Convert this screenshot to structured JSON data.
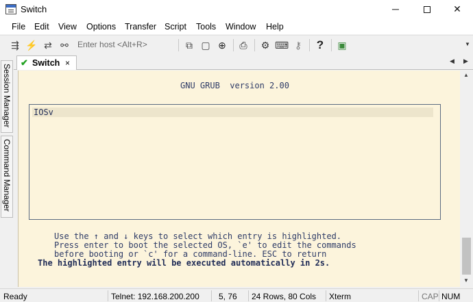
{
  "window": {
    "title": "Switch",
    "minimize_glyph": "─",
    "close_glyph": "✕"
  },
  "menu": [
    "File",
    "Edit",
    "View",
    "Options",
    "Transfer",
    "Script",
    "Tools",
    "Window",
    "Help"
  ],
  "toolbar": {
    "host_placeholder": "Enter host <Alt+R>",
    "icons": [
      "connect-icon",
      "quick-connect-icon",
      "reconnect-icon",
      "disconnect-icon",
      "copy-icon",
      "paste-icon",
      "find-icon",
      "print-icon",
      "settings-icon",
      "keymap-icon",
      "key-icon",
      "help-icon",
      "sftp-icon"
    ]
  },
  "tabs": [
    {
      "label": "Switch",
      "status": "connected",
      "close": "×"
    }
  ],
  "sidebar": {
    "session_manager": "Session Manager",
    "command_manager": "Command Manager"
  },
  "terminal": {
    "header": "GNU GRUB  version 2.00",
    "entries": [
      "IOSv"
    ],
    "help_lines": [
      "Use the ↑ and ↓ keys to select which entry is highlighted.",
      "Press enter to boot the selected OS, `e' to edit the commands",
      "before booting or `c' for a command-line. ESC to return"
    ],
    "countdown": "The highlighted entry will be executed automatically in 2s.",
    "background": "#fcf4dc",
    "foreground": "#2d3a66"
  },
  "status": {
    "state": "Ready",
    "connection": "Telnet: 192.168.200.200",
    "cursor": "5,  76",
    "size": "24 Rows, 80 Cols",
    "terminal_type": "Xterm",
    "caps": "CAP",
    "num": "NUM"
  }
}
